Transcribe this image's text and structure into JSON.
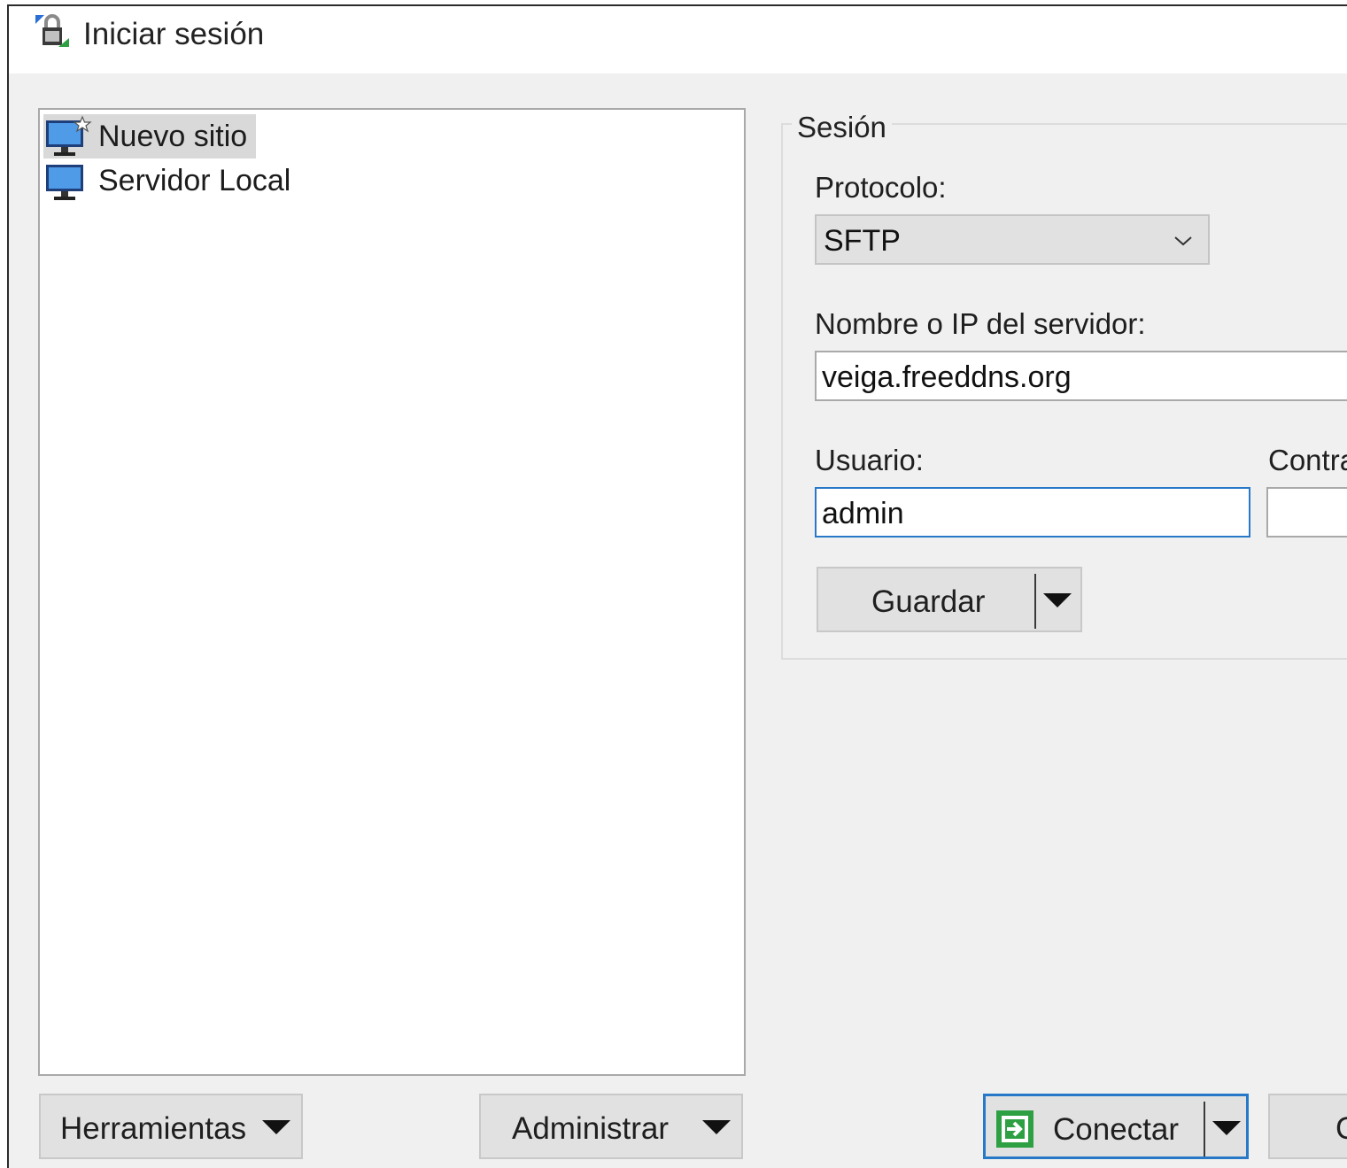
{
  "window": {
    "title": "Iniciar sesión"
  },
  "sites": [
    {
      "label": "Nuevo sitio",
      "icon": "new-site-monitor-icon",
      "selected": true
    },
    {
      "label": "Servidor Local",
      "icon": "monitor-icon",
      "selected": false
    }
  ],
  "session": {
    "group_title": "Sesión",
    "protocol_label": "Protocolo:",
    "protocol_value": "SFTP",
    "host_label": "Nombre o IP del servidor:",
    "host_value": "veiga.freeddns.org",
    "user_label": "Usuario:",
    "user_value": "admin",
    "password_label": "Contra",
    "save_button": "Guardar"
  },
  "footer": {
    "tools_button": "Herramientas",
    "manage_button": "Administrar",
    "connect_button": "Conectar",
    "next_button_partial": "C"
  },
  "colors": {
    "focus_border": "#2878c8",
    "button_bg": "#e1e1e1",
    "dialog_bg": "#f0f0f0",
    "selection_bg": "#d9d9d9"
  }
}
